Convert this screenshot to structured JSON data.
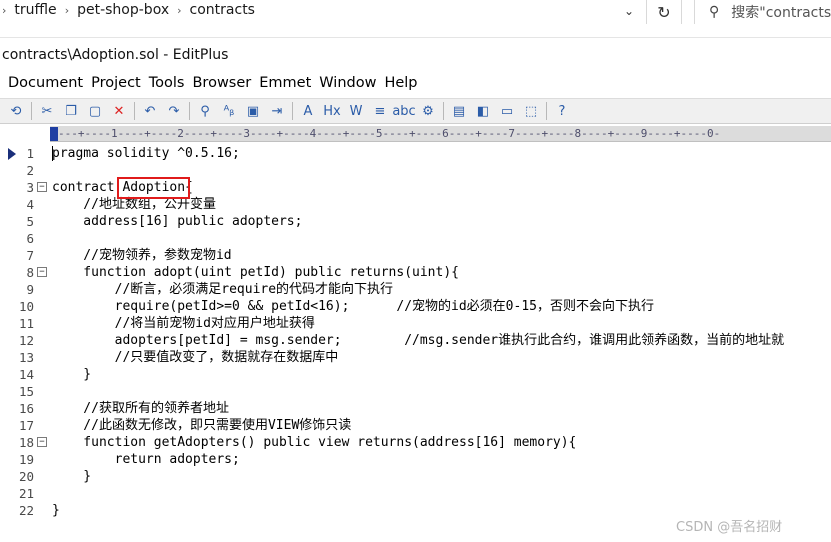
{
  "explorer": {
    "breadcrumbs": [
      "truffle",
      "pet-shop-box",
      "contracts"
    ],
    "search_placeholder": "搜索\"contracts\"",
    "dropdown_glyph": "⌄",
    "refresh_glyph": "↻",
    "search_glyph": "⚲",
    "sep_glyph": "›"
  },
  "window": {
    "title": "contracts\\Adoption.sol - EditPlus"
  },
  "menu": [
    "Document",
    "Project",
    "Tools",
    "Browser",
    "Emmet",
    "Window",
    "Help"
  ],
  "toolbar": {
    "buttons": [
      {
        "name": "sync-icon",
        "glyph": "⟲"
      },
      {
        "sep": true
      },
      {
        "name": "cut-icon",
        "glyph": "✂"
      },
      {
        "name": "copy-icon",
        "glyph": "❐"
      },
      {
        "name": "paste-icon",
        "glyph": "▢"
      },
      {
        "name": "delete-icon",
        "glyph": "✕",
        "color": "#d22"
      },
      {
        "sep": true
      },
      {
        "name": "undo-icon",
        "glyph": "↶"
      },
      {
        "name": "redo-icon",
        "glyph": "↷"
      },
      {
        "sep": true
      },
      {
        "name": "find-icon",
        "glyph": "⚲"
      },
      {
        "name": "replace-icon",
        "glyph": "ᴬᵦ"
      },
      {
        "name": "find-in-files-icon",
        "glyph": "▣"
      },
      {
        "name": "goto-line-icon",
        "glyph": "⇥"
      },
      {
        "sep": true
      },
      {
        "name": "font-icon",
        "glyph": "A"
      },
      {
        "name": "hex-icon",
        "glyph": "Hx"
      },
      {
        "name": "word-wrap-icon",
        "glyph": "W"
      },
      {
        "name": "line-number-icon",
        "glyph": "≡"
      },
      {
        "name": "spell-check-icon",
        "glyph": "abc"
      },
      {
        "name": "settings-gear-icon",
        "glyph": "⚙"
      },
      {
        "sep": true
      },
      {
        "name": "view-browser-icon",
        "glyph": "▤"
      },
      {
        "name": "split-window-icon",
        "glyph": "◧"
      },
      {
        "name": "output-window-icon",
        "glyph": "▭"
      },
      {
        "name": "tile-icon",
        "glyph": "⬚"
      },
      {
        "sep": true
      },
      {
        "name": "help-icon",
        "glyph": "?"
      }
    ]
  },
  "ruler": "---+----1----+----2----+----3----+----4----+----5----+----6----+----7----+----8----+----9----+----0-",
  "code_lines": [
    {
      "n": "1",
      "text": "pragma solidity ^0.5.16;",
      "marker": true
    },
    {
      "n": "2",
      "text": ""
    },
    {
      "n": "3",
      "text": "contract Adoption{",
      "fold": true
    },
    {
      "n": "4",
      "text": "    //地址数组，公开变量"
    },
    {
      "n": "5",
      "text": "    address[16] public adopters;"
    },
    {
      "n": "6",
      "text": ""
    },
    {
      "n": "7",
      "text": "    //宠物领养，参数宠物id"
    },
    {
      "n": "8",
      "text": "    function adopt(uint petId) public returns(uint){",
      "fold": true
    },
    {
      "n": "9",
      "text": "        //断言，必须满足require的代码才能向下执行"
    },
    {
      "n": "10",
      "text": "        require(petId>=0 && petId<16);      //宠物的id必须在0-15，否则不会向下执行"
    },
    {
      "n": "11",
      "text": "        //将当前宠物id对应用户地址获得"
    },
    {
      "n": "12",
      "text": "        adopters[petId] = msg.sender;        //msg.sender谁执行此合约，谁调用此领养函数，当前的地址就"
    },
    {
      "n": "13",
      "text": "        //只要值改变了，数据就存在数据库中"
    },
    {
      "n": "14",
      "text": "    }"
    },
    {
      "n": "15",
      "text": ""
    },
    {
      "n": "16",
      "text": "    //获取所有的领养者地址"
    },
    {
      "n": "17",
      "text": "    //此函数无修改，即只需要使用VIEW修饰只读"
    },
    {
      "n": "18",
      "text": "    function getAdopters() public view returns(address[16] memory){",
      "fold": true
    },
    {
      "n": "19",
      "text": "        return adopters;"
    },
    {
      "n": "20",
      "text": "    }"
    },
    {
      "n": "21",
      "text": ""
    },
    {
      "n": "22",
      "text": "}"
    }
  ],
  "watermark": "CSDN @吾名招财"
}
